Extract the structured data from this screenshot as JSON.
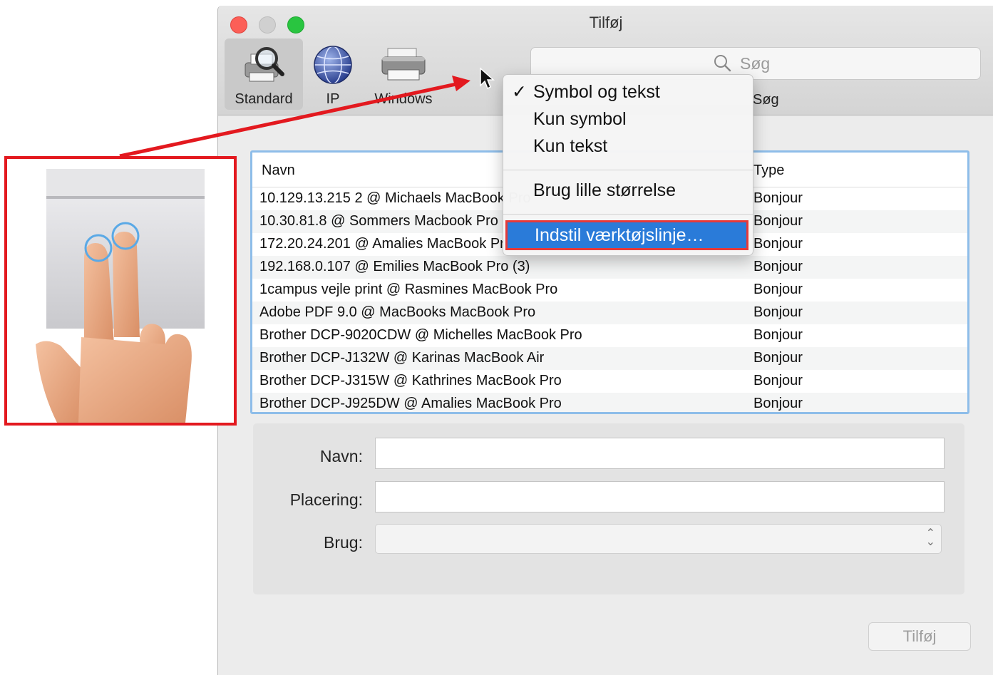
{
  "window": {
    "title": "Tilføj"
  },
  "toolbar": {
    "items": [
      {
        "label": "Standard",
        "icon": "printer-search-icon",
        "selected": true
      },
      {
        "label": "IP",
        "icon": "globe-icon",
        "selected": false
      },
      {
        "label": "Windows",
        "icon": "printer-icon",
        "selected": false
      }
    ],
    "search": {
      "placeholder": "Søg",
      "label": "Søg",
      "icon": "search-icon"
    }
  },
  "context_menu": {
    "items": [
      {
        "label": "Symbol og tekst",
        "checked": true
      },
      {
        "label": "Kun symbol",
        "checked": false
      },
      {
        "label": "Kun tekst",
        "checked": false
      },
      {
        "label": "Brug lille størrelse",
        "checked": false
      },
      {
        "label": "Indstil værktøjslinje…",
        "checked": false,
        "highlighted": true
      }
    ],
    "check_glyph": "✓",
    "highlight_color": "#2a7bd9"
  },
  "printer_table": {
    "columns": [
      "Navn",
      "Type"
    ],
    "rows": [
      {
        "name": "10.129.13.215 2 @ Michaels MacBook Pro",
        "type": "Bonjour"
      },
      {
        "name": "10.30.81.8 @ Sommers Macbook Pro",
        "type": "Bonjour"
      },
      {
        "name": "172.20.24.201 @ Amalies MacBook Pro",
        "type": "Bonjour"
      },
      {
        "name": "192.168.0.107 @ Emilies MacBook Pro (3)",
        "type": "Bonjour"
      },
      {
        "name": "1campus vejle print @ Rasmines MacBook Pro",
        "type": "Bonjour"
      },
      {
        "name": "Adobe PDF 9.0 @ MacBooks MacBook Pro",
        "type": "Bonjour"
      },
      {
        "name": "Brother DCP-9020CDW @ Michelles MacBook Pro",
        "type": "Bonjour"
      },
      {
        "name": "Brother DCP-J132W @ Karinas MacBook Air",
        "type": "Bonjour"
      },
      {
        "name": "Brother DCP-J315W @ Kathrines MacBook Pro",
        "type": "Bonjour"
      },
      {
        "name": "Brother DCP-J925DW @ Amalies MacBook Pro",
        "type": "Bonjour"
      }
    ]
  },
  "form": {
    "name_label": "Navn:",
    "name_value": "",
    "location_label": "Placering:",
    "location_value": "",
    "use_label": "Brug:",
    "use_value": ""
  },
  "add_button": {
    "label": "Tilføj",
    "enabled": false
  },
  "annotation": {
    "box_color": "#e3191f",
    "image": "two-finger-click-trackpad",
    "arrow_color": "#e3191f"
  }
}
